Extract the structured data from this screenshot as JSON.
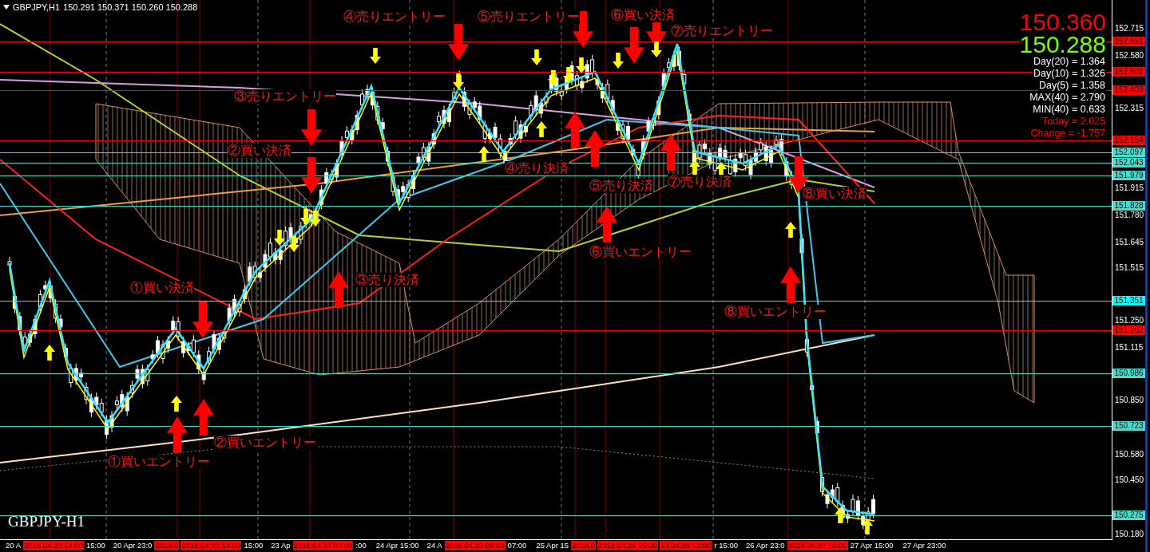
{
  "header": {
    "symbol": "GBPJPY,H1",
    "quotes": "150.291 150.371 150.260 150.288"
  },
  "info_panel": {
    "bid": "150.360",
    "ask": "150.288",
    "stats": [
      {
        "text": "Day(20) = 1.364",
        "kind": "normal"
      },
      {
        "text": "Day(10) = 1.326",
        "kind": "normal"
      },
      {
        "text": "Day(5) = 1.358",
        "kind": "normal"
      },
      {
        "text": "MAX(40) = 2.790",
        "kind": "normal"
      },
      {
        "text": "MIN(40) = 0.633",
        "kind": "normal"
      },
      {
        "text": "Today = 2.025",
        "kind": "alert"
      },
      {
        "text": "Change = -1.757",
        "kind": "alert"
      }
    ]
  },
  "signals": [
    {
      "text": "④売りエントリー"
    },
    {
      "text": "⑤売りエントリー"
    },
    {
      "text": "⑥買い決済"
    },
    {
      "text": "⑦売りエントリー"
    },
    {
      "text": "③売りエントリー"
    },
    {
      "text": "②買い決済"
    },
    {
      "text": "④売り決済"
    },
    {
      "text": "⑤売り決済"
    },
    {
      "text": "⑦売り決済"
    },
    {
      "text": "⑧買い決済"
    },
    {
      "text": "⑥買いエントリー"
    },
    {
      "text": "③売り決済"
    },
    {
      "text": "①買い決済"
    },
    {
      "text": "⑧買いエントリー"
    },
    {
      "text": "②買いエントリー"
    },
    {
      "text": "①買いエントリー"
    }
  ],
  "chart_label": "GBPJPY-H1",
  "price_axis": {
    "ticks": [
      "152.715",
      "152.580",
      "152.315",
      "151.915",
      "151.780",
      "151.645",
      "151.515",
      "151.250",
      "151.115",
      "150.850",
      "150.580",
      "150.450",
      "150.180"
    ],
    "levels": [
      {
        "text": "152.651",
        "color": "#ff0000"
      },
      {
        "text": "152.501",
        "color": "#ff0000"
      },
      {
        "text": "152.409",
        "color": "#ff0000"
      },
      {
        "text": "152.154",
        "color": "#ff0000"
      },
      {
        "text": "152.097",
        "color": "#40e0d0"
      },
      {
        "text": "152.043",
        "color": "#40e0d0"
      },
      {
        "text": "151.979",
        "color": "#40e0d0"
      },
      {
        "text": "151.828",
        "color": "#40e0d0"
      },
      {
        "text": "151.351",
        "color": "#00ffff"
      },
      {
        "text": "151.202",
        "color": "#ff0000"
      },
      {
        "text": "150.986",
        "color": "#40e0d0"
      },
      {
        "text": "150.723",
        "color": "#40e0d0"
      },
      {
        "text": "150.275",
        "color": "#40e0d0"
      }
    ]
  },
  "time_axis": [
    {
      "text": "20 A",
      "kind": "time"
    },
    {
      "text": "2018.04.20 14:00",
      "kind": "marker"
    },
    {
      "text": "15:00",
      "kind": "time"
    },
    {
      "text": "20 Apr 23:0",
      "kind": "time"
    },
    {
      "text": "2018.0",
      "kind": "marker"
    },
    {
      "text": "2018.04.23 14:00",
      "kind": "marker"
    },
    {
      "text": "15:00",
      "kind": "time"
    },
    {
      "text": "23 Ap",
      "kind": "time"
    },
    {
      "text": "2018.04.24 07:00",
      "kind": "marker"
    },
    {
      "text": ":00",
      "kind": "time"
    },
    {
      "text": "24 Apr 15:00",
      "kind": "time"
    },
    {
      "text": "24 A",
      "kind": "time"
    },
    {
      "text": "2018.04.25 06:00",
      "kind": "marker"
    },
    {
      "text": "07:00",
      "kind": "time"
    },
    {
      "text": "25 Apr 15",
      "kind": "time"
    },
    {
      "text": "2018.0",
      "kind": "marker"
    },
    {
      "text": "2018.04.26 05:00",
      "kind": "marker"
    },
    {
      "text": "18.04.26 13:00",
      "kind": "marker"
    },
    {
      "text": "r 15:00",
      "kind": "time"
    },
    {
      "text": "26 Apr 23:0",
      "kind": "time"
    },
    {
      "text": "2018.04.27 10:00",
      "kind": "marker"
    },
    {
      "text": "27 Apr 15:00",
      "kind": "time"
    },
    {
      "text": "27 Apr 23:00",
      "kind": "time"
    }
  ]
}
